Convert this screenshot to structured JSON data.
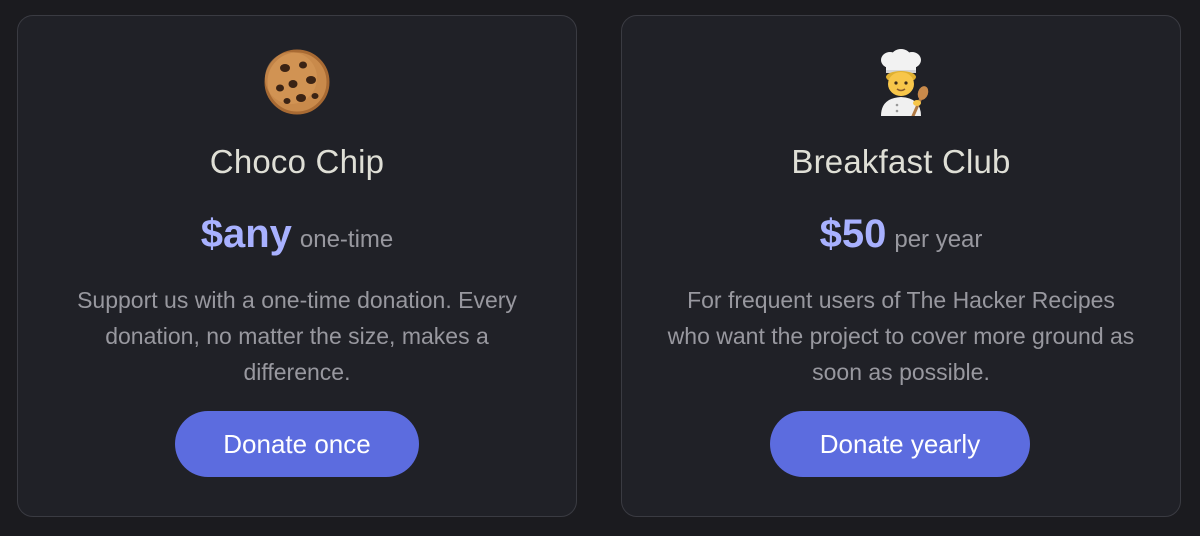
{
  "cards": [
    {
      "icon": "cookie-icon",
      "title": "Choco Chip",
      "price": "$any",
      "period": "one-time",
      "description": "Support us with a one-time donation. Every donation, no matter the size, makes a difference.",
      "button_label": "Donate once"
    },
    {
      "icon": "cook-icon",
      "title": "Breakfast Club",
      "price": "$50",
      "period": "per year",
      "description": "For frequent users of The Hacker Recipes who want the project to cover more ground as soon as possible.",
      "button_label": "Donate yearly"
    }
  ],
  "colors": {
    "background": "#1b1b1f",
    "card": "#202127",
    "accent_price": "#a8b1ff",
    "button": "#5c6cdf"
  }
}
